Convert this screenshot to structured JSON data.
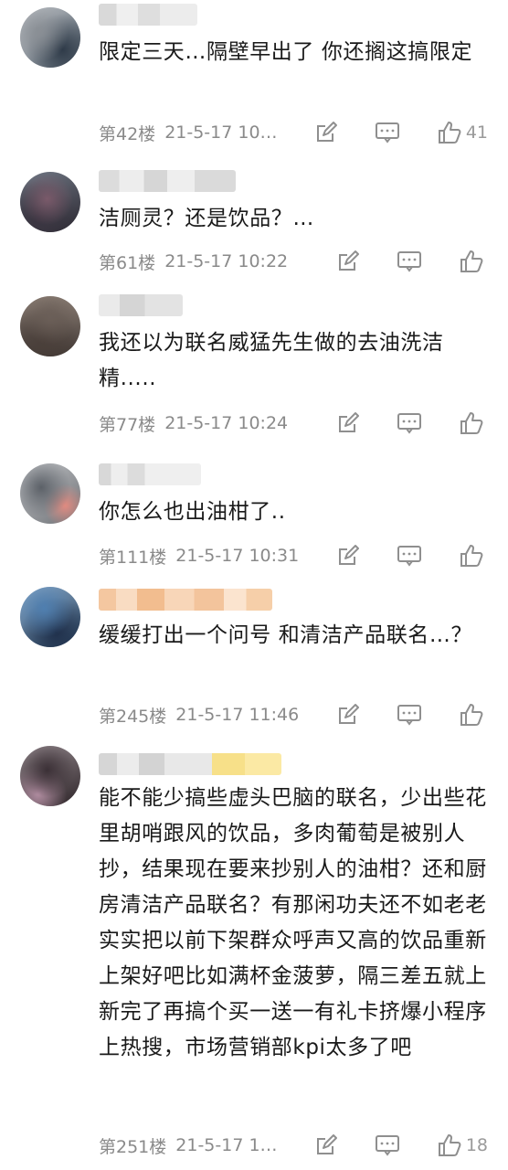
{
  "comments": [
    {
      "text": "限定三天…隔壁早出了 你还搁这搞限定",
      "floor": "第42楼",
      "time": "21-5-17 10…",
      "likes": "41"
    },
    {
      "text": "洁厕灵？还是饮品？…",
      "floor": "第61楼",
      "time": "21-5-17 10:22",
      "likes": ""
    },
    {
      "text": "我还以为联名威猛先生做的去油洗洁精.....",
      "floor": "第77楼",
      "time": "21-5-17 10:24",
      "likes": ""
    },
    {
      "text": "你怎么也出油柑了..",
      "floor": "第111楼",
      "time": "21-5-17 10:31",
      "likes": ""
    },
    {
      "text": "缓缓打出一个问号 和清洁产品联名…？",
      "floor": "第245楼",
      "time": "21-5-17 11:46",
      "likes": ""
    },
    {
      "text": "能不能少搞些虚头巴脑的联名，少出些花里胡哨跟风的饮品，多肉葡萄是被别人抄，结果现在要来抄别人的油柑？还和厨房清洁产品联名？有那闲功夫还不如老老实实把以前下架群众呼声又高的饮品重新上架好吧比如满杯金菠萝，隔三差五就上新完了再搞个买一送一有礼卡挤爆小程序上热搜，市场营销部kpi太多了吧",
      "floor": "第251楼",
      "time": "21-5-17 1…",
      "likes": "18"
    }
  ]
}
